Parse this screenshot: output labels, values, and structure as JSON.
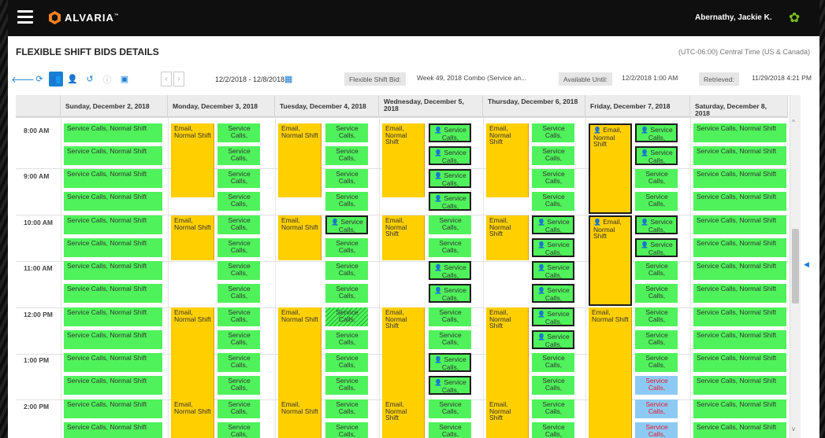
{
  "app": {
    "brand": "ALVARIA",
    "trademark": "™",
    "user": "Abernathy, Jackie K."
  },
  "page": {
    "title": "FLEXIBLE SHIFT BIDS DETAILS",
    "timezone": "(UTC-06:00) Central Time (US & Canada)"
  },
  "toolbar": {
    "date_range": "12/2/2018 - 12/8/2018",
    "flex_label": "Flexible Shift Bid:",
    "flex_value": "Week 49, 2018 Combo (Service an...",
    "available_label": "Available Until:",
    "available_value": "12/2/2018 1:00 AM",
    "retrieved_label": "Retrieved:",
    "retrieved_value": "11/29/2018 4:21 PM"
  },
  "days": [
    "Sunday, December 2, 2018",
    "Monday, December 3, 2018",
    "Tuesday, December 4, 2018",
    "Wednesday, December 5, 2018",
    "Thursday, December 6, 2018",
    "Friday, December 7, 2018",
    "Saturday, December 8, 2018"
  ],
  "times": [
    "8:00 AM",
    "9:00 AM",
    "10:00 AM",
    "11:00 AM",
    "12:00 PM",
    "1:00 PM",
    "2:00 PM"
  ],
  "labels": {
    "wide": "Service Calls, Normal Shift",
    "narrow": "Service Calls,",
    "email": "Email, Normal Shift"
  },
  "colors": {
    "available": "#4ff25a",
    "email_shift": "#ffcf00",
    "alt": "#8dcaf3",
    "accent": "#1a7fd4"
  },
  "icons": [
    "menu-icon",
    "logo-icon",
    "gear-icon",
    "back-icon",
    "refresh-icon",
    "people-icon",
    "person-icon",
    "undo-icon",
    "info-icon",
    "save-icon",
    "prev-icon",
    "next-icon",
    "calendar-icon",
    "bid-person-icon"
  ]
}
